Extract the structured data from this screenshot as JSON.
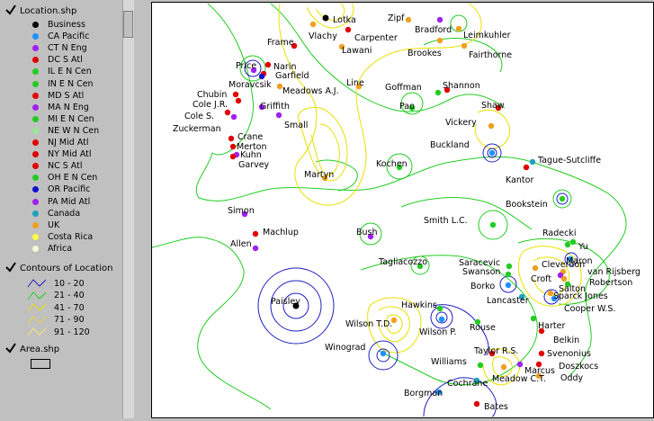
{
  "legend": {
    "location_layer": "Location.shp",
    "location_items": [
      {
        "label": "Business",
        "color": "#000000"
      },
      {
        "label": "CA Pacific",
        "color": "#1e90ff"
      },
      {
        "label": "CT N Eng",
        "color": "#a020f0"
      },
      {
        "label": "DC S Atl",
        "color": "#e00000"
      },
      {
        "label": "IL E N Cen",
        "color": "#22cc22"
      },
      {
        "label": "IN E N Cen",
        "color": "#22cc22"
      },
      {
        "label": "MD S Atl",
        "color": "#e00000"
      },
      {
        "label": "MA N Eng",
        "color": "#a020f0"
      },
      {
        "label": "MI E N Cen",
        "color": "#22cc22"
      },
      {
        "label": "NE W N Cen",
        "color": "#98e898"
      },
      {
        "label": "NJ Mid Atl",
        "color": "#e00000"
      },
      {
        "label": "NY Mid Atl",
        "color": "#e00000"
      },
      {
        "label": "NC S Atl",
        "color": "#e00000"
      },
      {
        "label": "OH E N Cen",
        "color": "#22cc22"
      },
      {
        "label": "OR Pacific",
        "color": "#1010d0"
      },
      {
        "label": "PA Mid Atl",
        "color": "#a020f0"
      },
      {
        "label": "Canada",
        "color": "#20a0c0"
      },
      {
        "label": "UK",
        "color": "#f0a020"
      },
      {
        "label": "Costa Rica",
        "color": "#ffff40"
      },
      {
        "label": "Africa",
        "color": "#f8f8d8"
      }
    ],
    "contour_layer": "Contours of Location",
    "contour_items": [
      {
        "label": "10 - 20",
        "color": "#2020c0"
      },
      {
        "label": "21 - 40",
        "color": "#22cc22"
      },
      {
        "label": "41 - 70",
        "color": "#e8e000"
      },
      {
        "label": "71 - 90",
        "color": "#f0d040"
      },
      {
        "label": "91 - 120",
        "color": "#f8e870"
      }
    ],
    "area_layer": "Area.shp"
  },
  "map": {
    "points": [
      {
        "name": "Lotka",
        "color": "#000000"
      },
      {
        "name": "Zipf",
        "color": "#f0a020"
      },
      {
        "name": "Bradford",
        "color": "#a020f0"
      },
      {
        "name": "Leimkuhler",
        "color": "#f0a020"
      },
      {
        "name": "Frame",
        "color": "#e00000"
      },
      {
        "name": "Vlachy",
        "color": "#f0a020"
      },
      {
        "name": "Carpenter",
        "color": "#e00000"
      },
      {
        "name": "Lawani",
        "color": "#f0a020"
      },
      {
        "name": "Brookes",
        "color": "#f0a020"
      },
      {
        "name": "Fairthorne",
        "color": "#f0a020"
      },
      {
        "name": "Price",
        "color": "#a020f0"
      },
      {
        "name": "Narin",
        "color": "#e00000"
      },
      {
        "name": "Garfield",
        "color": "#e00000"
      },
      {
        "name": "Moravcsik",
        "color": "#1010d0"
      },
      {
        "name": "Meadows A.J.",
        "color": "#f0a020"
      },
      {
        "name": "Line",
        "color": "#f0a020"
      },
      {
        "name": "Goffman",
        "color": "#22cc22"
      },
      {
        "name": "Shannon",
        "color": "#e00000"
      },
      {
        "name": "Chubin",
        "color": "#e00000"
      },
      {
        "name": "Cole J.R.",
        "color": "#e00000"
      },
      {
        "name": "Cole S.",
        "color": "#e00000"
      },
      {
        "name": "Griffith",
        "color": "#a020f0"
      },
      {
        "name": "Small",
        "color": "#a020f0"
      },
      {
        "name": "Pao",
        "color": "#22cc22"
      },
      {
        "name": "Shaw",
        "color": "#e00000"
      },
      {
        "name": "Zuckerman",
        "color": "#a020f0"
      },
      {
        "name": "Vickery",
        "color": "#f0a020"
      },
      {
        "name": "Crane",
        "color": "#e00000"
      },
      {
        "name": "Merton",
        "color": "#e00000"
      },
      {
        "name": "Kuhn",
        "color": "#a020f0"
      },
      {
        "name": "Garvey",
        "color": "#e00000"
      },
      {
        "name": "Buckland",
        "color": "#1e90ff"
      },
      {
        "name": "Tague-Sutcliffe",
        "color": "#20a0c0"
      },
      {
        "name": "Kochen",
        "color": "#22cc22"
      },
      {
        "name": "Martyn",
        "color": "#f0a020"
      },
      {
        "name": "Kantor",
        "color": "#e00000"
      },
      {
        "name": "Bookstein",
        "color": "#22cc22"
      },
      {
        "name": "Simon",
        "color": "#a020f0"
      },
      {
        "name": "Smith L.C.",
        "color": "#22cc22"
      },
      {
        "name": "Radecki",
        "color": "#22cc22"
      },
      {
        "name": "Machlup",
        "color": "#e00000"
      },
      {
        "name": "Bush",
        "color": "#a020f0"
      },
      {
        "name": "Yu",
        "color": "#22cc22"
      },
      {
        "name": "Allen",
        "color": "#a020f0"
      },
      {
        "name": "Maron",
        "color": "#1e90ff"
      },
      {
        "name": "Tagliacozzo",
        "color": "#22cc22"
      },
      {
        "name": "Saracevic",
        "color": "#22cc22"
      },
      {
        "name": "Cleverdon",
        "color": "#f0a020"
      },
      {
        "name": "Swanson",
        "color": "#22cc22"
      },
      {
        "name": "van Rijsberg",
        "color": "#f0a020"
      },
      {
        "name": "Croft",
        "color": "#a020f0"
      },
      {
        "name": "Robertson",
        "color": "#f0a020"
      },
      {
        "name": "Borko",
        "color": "#1e90ff"
      },
      {
        "name": "Salton",
        "color": "#22cc22"
      },
      {
        "name": "Sparck Jones",
        "color": "#f0a020"
      },
      {
        "name": "Paisley",
        "color": "#000000"
      },
      {
        "name": "Lancaster",
        "color": "#20a0c0"
      },
      {
        "name": "Cooper W.S.",
        "color": "#1e90ff"
      },
      {
        "name": "Hawkins",
        "color": "#22cc22"
      },
      {
        "name": "Wilson T.D.",
        "color": "#f0a020"
      },
      {
        "name": "Wilson P.",
        "color": "#1e90ff"
      },
      {
        "name": "Rouse",
        "color": "#22cc22"
      },
      {
        "name": "Harter",
        "color": "#22cc22"
      },
      {
        "name": "Belkin",
        "color": "#e00000"
      },
      {
        "name": "Winograd",
        "color": "#1e90ff"
      },
      {
        "name": "Taylor R.S.",
        "color": "#e00000"
      },
      {
        "name": "Svenonius",
        "color": "#e00000"
      },
      {
        "name": "Williams",
        "color": "#22cc22"
      },
      {
        "name": "Doszkocs",
        "color": "#e00000"
      },
      {
        "name": "Marcus",
        "color": "#a020f0"
      },
      {
        "name": "Meadow C.T.",
        "color": "#f0a020"
      },
      {
        "name": "Oddy",
        "color": "#f0a020"
      },
      {
        "name": "Cochrane",
        "color": "#20a0c0"
      },
      {
        "name": "Borgman",
        "color": "#1e90ff"
      },
      {
        "name": "Bates",
        "color": "#e00000"
      }
    ]
  }
}
